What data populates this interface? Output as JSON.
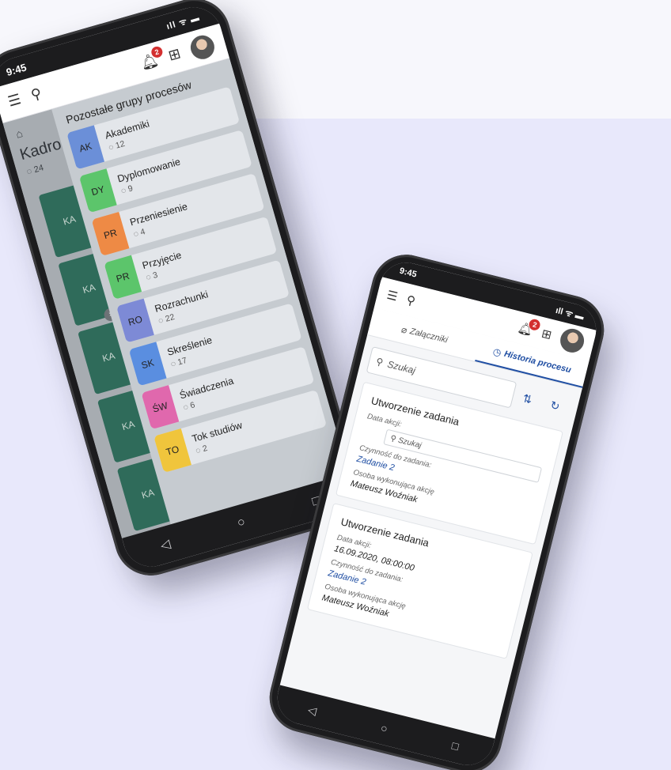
{
  "phone_left": {
    "status_time": "9:45",
    "status_icons": "ıll ᯤ ▬",
    "notifications_count": "2",
    "breadcrumb_home_icon": "home-icon",
    "page_title_partial": "Kadro",
    "page_count_partial": "◌ 24",
    "background_cards": [
      "KA",
      "KA",
      "KA",
      "KA",
      "KA"
    ],
    "panel_title": "Pozostałe grupy procesów",
    "groups": [
      {
        "abbr": "AK",
        "name": "Akademiki",
        "count": "◌ 12",
        "color": "#6b8fd8"
      },
      {
        "abbr": "DY",
        "name": "Dyplomowanie",
        "count": "◌ 9",
        "color": "#5cc56b"
      },
      {
        "abbr": "PR",
        "name": "Przeniesienie",
        "count": "◌ 4",
        "color": "#ee8a45"
      },
      {
        "abbr": "PR",
        "name": "Przyjęcie",
        "count": "◌ 3",
        "color": "#5cc56b"
      },
      {
        "abbr": "RO",
        "name": "Rozrachunki",
        "count": "◌ 22",
        "color": "#7d8ad6"
      },
      {
        "abbr": "SK",
        "name": "Skreślenie",
        "count": "◌ 17",
        "color": "#5a8ee0"
      },
      {
        "abbr": "ŚW",
        "name": "Świadczenia",
        "count": "◌ 6",
        "color": "#e068ad"
      },
      {
        "abbr": "TO",
        "name": "Tok studiów",
        "count": "◌ 2",
        "color": "#f0c53c"
      }
    ],
    "nav": [
      "◁",
      "○",
      "□"
    ]
  },
  "phone_right": {
    "status_time": "9:45",
    "status_icons": "ıll ᯤ ▬",
    "notifications_count": "2",
    "tabs": [
      {
        "label": "Załączniki",
        "icon": "paperclip-icon",
        "glyph": "⌀"
      },
      {
        "label": "Historia procesu",
        "icon": "clock-icon",
        "glyph": "◷"
      }
    ],
    "search_placeholder": "Szukaj",
    "history": [
      {
        "title": "Utworzenie zadania",
        "date_label": "Data akcji:",
        "date_value": "",
        "date_search": "Szukaj",
        "task_label": "Czynność do zadania:",
        "task_value": "Zadanie 2",
        "person_label": "Osoba wykonująca akcję",
        "person_value": "Mateusz Woźniak"
      },
      {
        "title": "Utworzenie zadania",
        "date_label": "Data akcji:",
        "date_value": "16.09.2020, 08:00:00",
        "task_label": "Czynność do zadania:",
        "task_value": "Zadanie 2",
        "person_label": "Osoba wykonująca akcję",
        "person_value": "Mateusz Woźniak"
      }
    ],
    "nav": [
      "◁",
      "○",
      "□"
    ]
  }
}
